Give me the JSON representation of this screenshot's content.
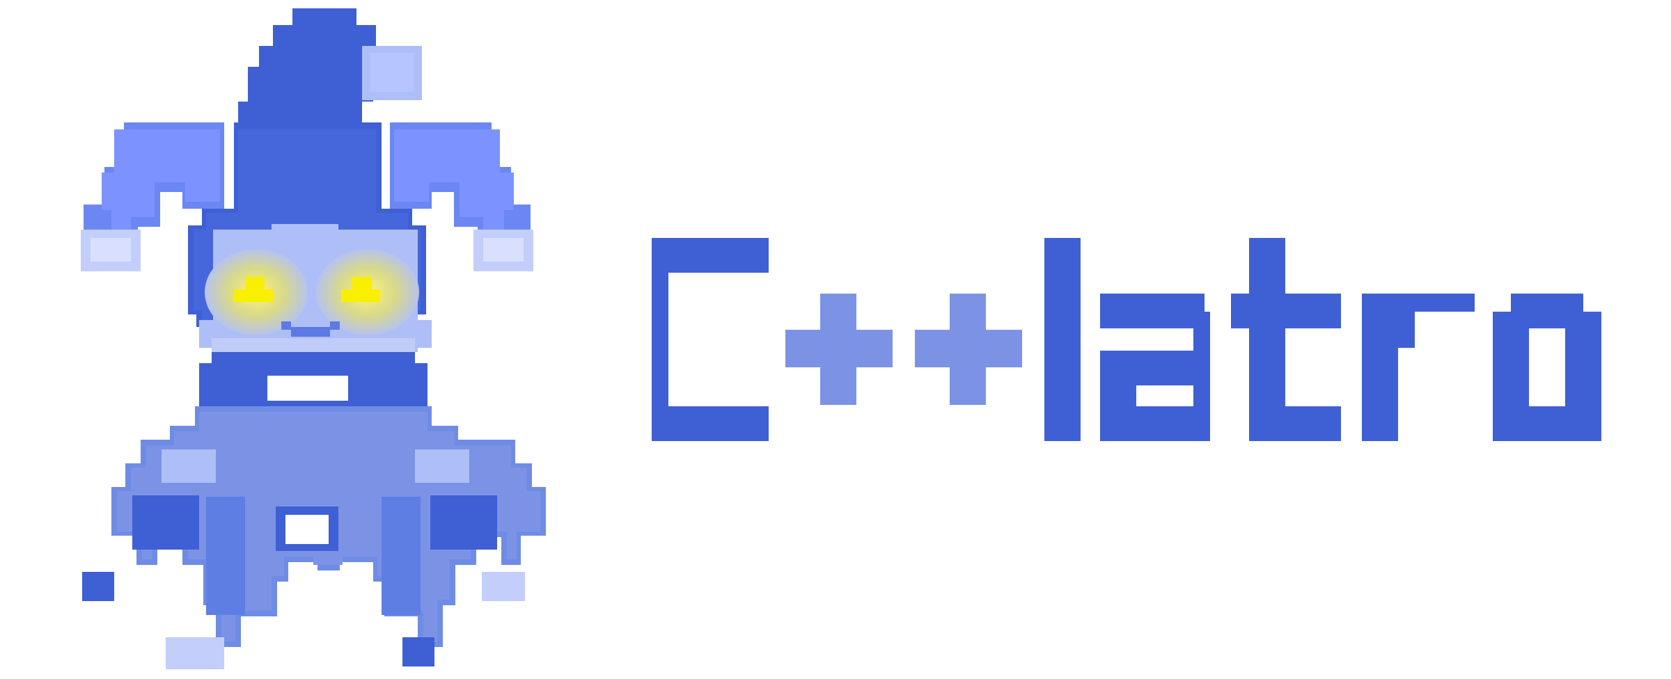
{
  "logo": {
    "wordmark": "C++latro",
    "primary_color": "#3F60D4",
    "secondary_color": "#7C93E5",
    "eye_color": "#F8F000",
    "mascot_icon": "jester-mascot-icon"
  }
}
